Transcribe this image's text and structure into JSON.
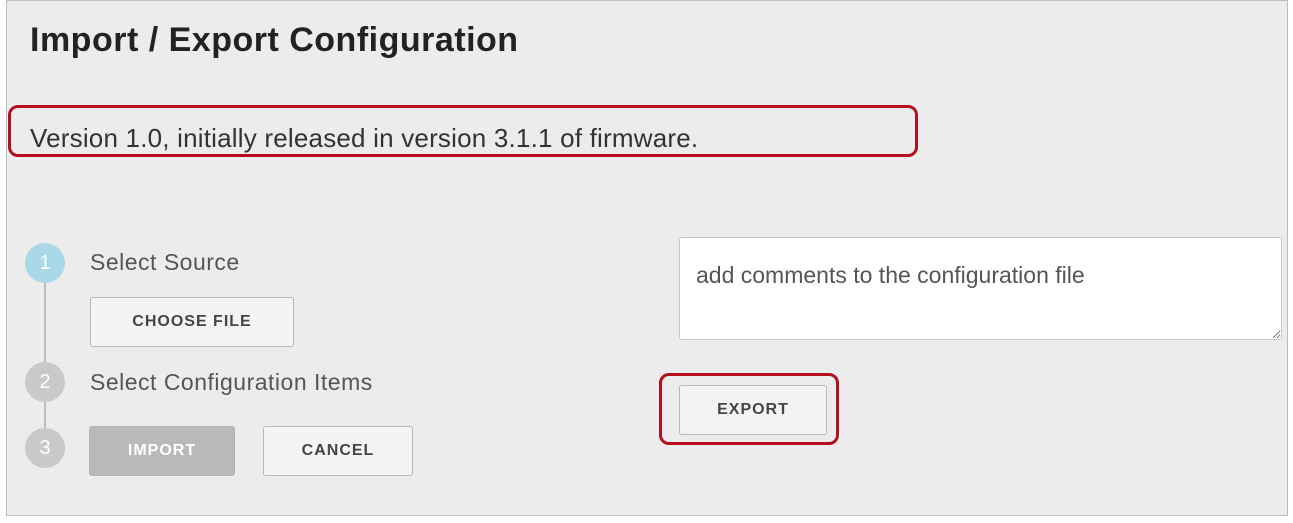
{
  "page": {
    "title": "Import / Export Configuration",
    "version_text": "Version 1.0, initially released in version 3.1.1 of firmware."
  },
  "steps": [
    {
      "number": "1",
      "label": "Select Source",
      "status": "active"
    },
    {
      "number": "2",
      "label": "Select Configuration Items",
      "status": "inactive"
    },
    {
      "number": "3",
      "label": "",
      "status": "inactive"
    }
  ],
  "buttons": {
    "choose_file": "CHOOSE FILE",
    "import": "IMPORT",
    "cancel": "CANCEL",
    "export": "EXPORT"
  },
  "export": {
    "comments_placeholder": "add comments to the configuration file",
    "comments_value": ""
  },
  "colors": {
    "active_step": "#a9d8e8",
    "inactive_step": "#c9c9c9",
    "highlight": "#b30f1f",
    "panel_bg": "#ececec"
  }
}
